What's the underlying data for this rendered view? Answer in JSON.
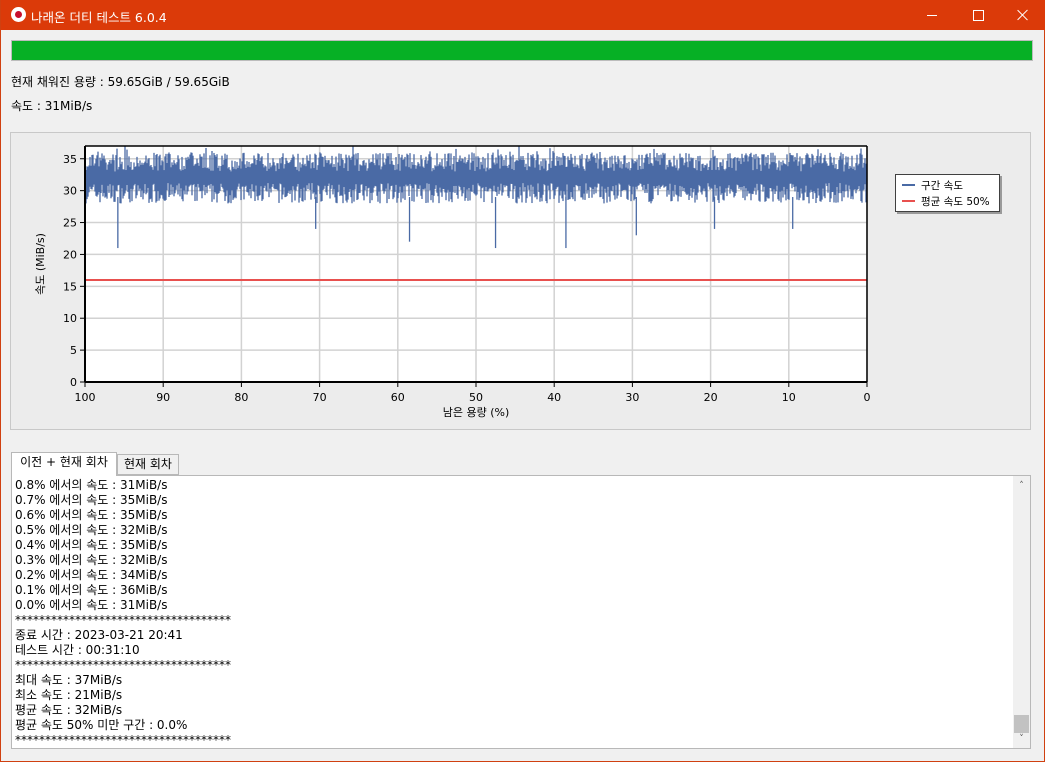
{
  "window": {
    "title": "나래온 더티 테스트 6.0.4"
  },
  "progress": {
    "fraction": 1.0,
    "color": "#06b025"
  },
  "status": {
    "capacity": "현재 채워진 용량 : 59.65GiB / 59.65GiB",
    "speed": "속도 : 31MiB/s"
  },
  "chart_data": {
    "type": "area",
    "xlabel": "남은 용량 (%)",
    "ylabel": "속도 (MiB/s)",
    "xlim": [
      100,
      0
    ],
    "ylim": [
      0,
      37
    ],
    "x_ticks": [
      "100",
      "90",
      "80",
      "70",
      "60",
      "50",
      "40",
      "30",
      "20",
      "10",
      "0"
    ],
    "y_ticks": [
      "0",
      "5",
      "10",
      "15",
      "20",
      "25",
      "30",
      "35"
    ],
    "grid": true,
    "legend_position": "right",
    "series": [
      {
        "name": "구간 속도",
        "color": "#4a6aa5",
        "band_low": 28,
        "band_high": 36,
        "min": 21,
        "max": 37,
        "dips": [
          [
            95.8,
            21
          ],
          [
            70.5,
            24
          ],
          [
            58.5,
            22
          ],
          [
            47.5,
            21
          ],
          [
            38.5,
            21
          ],
          [
            29.5,
            23
          ],
          [
            19.5,
            24
          ],
          [
            9.5,
            24
          ]
        ]
      },
      {
        "name": "평균 속도 50%",
        "color": "#e8504e",
        "value": 16
      }
    ]
  },
  "tabs": [
    {
      "label": "이전 + 현재 회차",
      "active": true
    },
    {
      "label": "현재 회차",
      "active": false
    }
  ],
  "log": [
    "0.8% 에서의 속도 : 31MiB/s",
    "0.7% 에서의 속도 : 35MiB/s",
    "0.6% 에서의 속도 : 35MiB/s",
    "0.5% 에서의 속도 : 32MiB/s",
    "0.4% 에서의 속도 : 35MiB/s",
    "0.3% 에서의 속도 : 32MiB/s",
    "0.2% 에서의 속도 : 34MiB/s",
    "0.1% 에서의 속도 : 36MiB/s",
    "0.0% 에서의 속도 : 31MiB/s",
    "************************************",
    "종료 시간 : 2023-03-21 20:41",
    "테스트 시간 : 00:31:10",
    "************************************",
    "최대 속도 : 37MiB/s",
    "최소 속도 : 21MiB/s",
    "평균 속도 : 32MiB/s",
    "평균 속도 50% 미만 구간 : 0.0%",
    "************************************"
  ]
}
